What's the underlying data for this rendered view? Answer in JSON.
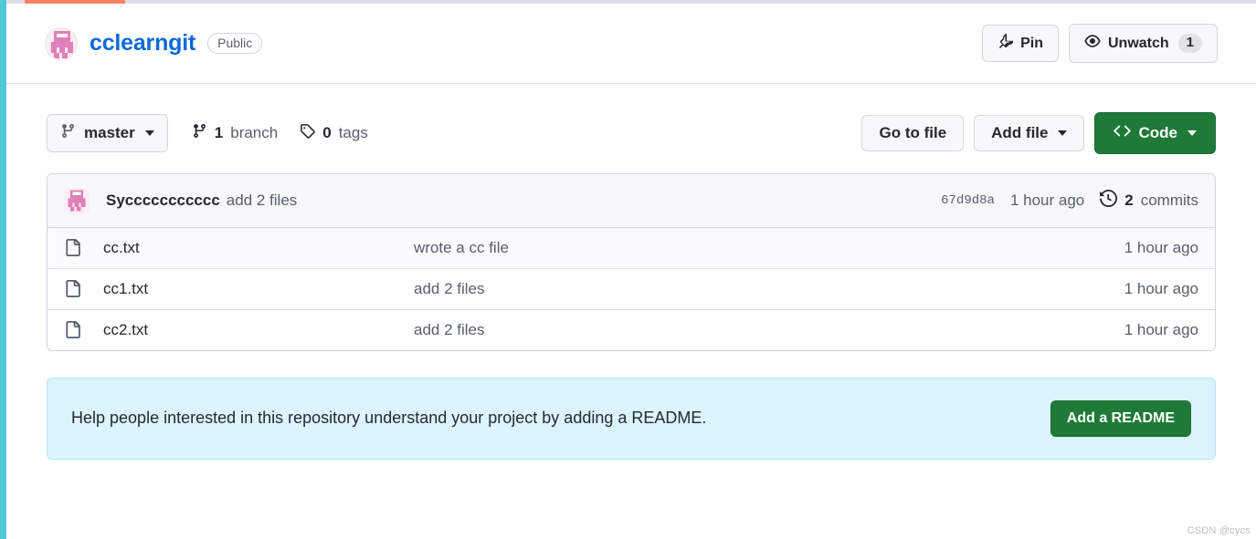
{
  "browser_chrome": {
    "left_strip_color": "#4fc9d4",
    "top_rule_color": "#dfe1e4",
    "progress_color": "#fb8164"
  },
  "repo_header": {
    "avatar_icon": "repo-owner-avatar-icon",
    "repo_name": "cclearngit",
    "visibility": "Public",
    "actions": [
      {
        "name": "pin-button",
        "icon": "pin-icon",
        "label": "Pin",
        "count": null
      },
      {
        "name": "unwatch-button",
        "icon": "eye-icon",
        "label": "Unwatch",
        "count": "1"
      }
    ]
  },
  "toolbar": {
    "branch_icon": "git-branch-icon",
    "branch_name": "master",
    "branch_count": "1",
    "branch_label": "branch",
    "tag_icon": "tag-icon",
    "tag_count": "0",
    "tag_label": "tags",
    "go_to_file_label": "Go to file",
    "add_file_label": "Add file",
    "code_icon": "code-brackets-icon",
    "code_label": "Code"
  },
  "commit_bar": {
    "avatar_icon": "commit-author-avatar-icon",
    "author": "Syccccccccccc",
    "message": "add 2 files",
    "sha": "67d9d8a",
    "time": "1 hour ago",
    "history_icon": "history-clock-icon",
    "commit_count": "2",
    "commit_count_label": "commits"
  },
  "files": [
    {
      "icon": "file-icon",
      "name": "cc.txt",
      "commit_message": "wrote a cc file",
      "time": "1 hour ago"
    },
    {
      "icon": "file-icon",
      "name": "cc1.txt",
      "commit_message": "add 2 files",
      "time": "1 hour ago"
    },
    {
      "icon": "file-icon",
      "name": "cc2.txt",
      "commit_message": "add 2 files",
      "time": "1 hour ago"
    }
  ],
  "readme_banner": {
    "text": "Help people interested in this repository understand your project by adding a README.",
    "button_label": "Add a README",
    "background_color": "#ddf4ff",
    "button_color": "#1f7a37"
  },
  "watermark": {
    "text": "CSDN @cycs"
  }
}
